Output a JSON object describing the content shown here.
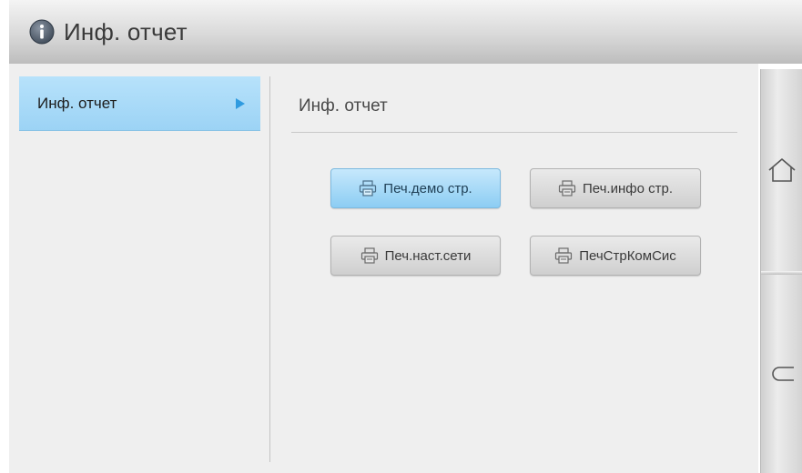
{
  "header": {
    "title": "Инф. отчет",
    "icon": "info-icon"
  },
  "menu": {
    "items": [
      {
        "label": "Инф. отчет",
        "selected": true,
        "icon": "arrow-right-icon"
      }
    ]
  },
  "panel": {
    "title": "Инф. отчет",
    "buttons": [
      {
        "label": "Печ.демо стр.",
        "icon": "printer-icon",
        "state": "active"
      },
      {
        "label": "Печ.инфо стр.",
        "icon": "printer-icon",
        "state": "normal"
      },
      {
        "label": "Печ.наст.сети",
        "icon": "printer-icon",
        "state": "normal"
      },
      {
        "label": "ПечСтрКомСис",
        "icon": "printer-icon",
        "state": "normal"
      }
    ]
  },
  "sidebar": {
    "home_icon": "home-icon",
    "back_icon": "back-icon"
  },
  "colors": {
    "accent": "#9cd3f5",
    "title_bar": "#d9d9d9",
    "content_bg": "#efefef"
  }
}
